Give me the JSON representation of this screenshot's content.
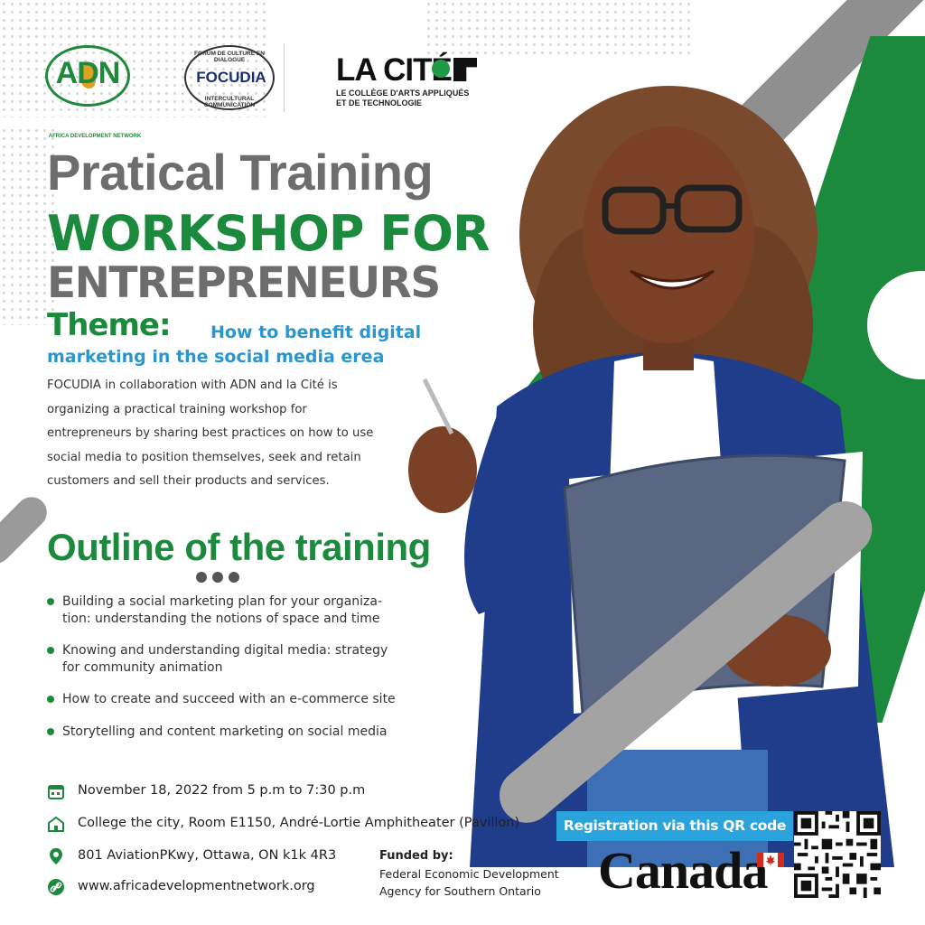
{
  "logos": {
    "adn": {
      "letters": "ADN",
      "caption": "AFRICA DEVELOPMENT NETWORK"
    },
    "focudia": {
      "top_text": "FORUM DE CULTURE EN DIALOGUE",
      "name": "FOCUDIA",
      "bottom_text": "INTERCULTURAL COMMUNICATION"
    },
    "lacite": {
      "name": "LA CITÉ",
      "sub_line1": "LE COLLÈGE D'ARTS APPLIQUÉS",
      "sub_line2": "ET DE TECHNOLOGIE"
    }
  },
  "headline": {
    "line1": "Pratical Training",
    "line2": "WORKSHOP FOR",
    "line3": "ENTREPRENEURS"
  },
  "theme": {
    "label": "Theme:",
    "text_line1": "How to benefit digital",
    "text_line2": "marketing in the social media erea"
  },
  "intro": {
    "lines": [
      "FOCUDIA in collaboration with ADN and la Cité is",
      "organizing a practical training workshop for",
      "entrepreneurs by sharing best practices on how to use",
      "social media to position themselves, seek and retain",
      "customers and sell their products and services."
    ]
  },
  "outline": {
    "title": "Outline of the training",
    "items": [
      {
        "line1": "Building a social marketing plan for your organiza-",
        "line2": "tion: understanding the notions of space and time"
      },
      {
        "line1": "Knowing and understanding digital media: strategy",
        "line2": "for community animation"
      },
      {
        "line1": "How to create and succeed with an e-commerce site",
        "line2": ""
      },
      {
        "line1": "Storytelling and content marketing on social media",
        "line2": ""
      }
    ]
  },
  "info": {
    "date": "November 18, 2022 from 5 p.m to 7:30 p.m",
    "venue": "College the city, Room E1150, André-Lortie Amphitheater (Pavillon)",
    "address": "801 AviationPKwy, Ottawa, ON k1k 4R3",
    "website": "www.africadevelopmentnetwork.org"
  },
  "registration": {
    "banner": "Registration via this QR code"
  },
  "funding": {
    "label": "Funded by:",
    "org_line1": "Federal Economic Development",
    "org_line2": "Agency for Southern Ontario",
    "wordmark": "Canada"
  },
  "icons": [
    "calendar-icon",
    "building-icon",
    "location-pin-icon",
    "link-icon",
    "qr-code-icon",
    "canada-flag-icon"
  ],
  "colors": {
    "green": "#1b8a3d",
    "gray": "#6d6d6d",
    "blue": "#2a96cf",
    "banner": "#2aa3dd",
    "red": "#d52b1e"
  }
}
